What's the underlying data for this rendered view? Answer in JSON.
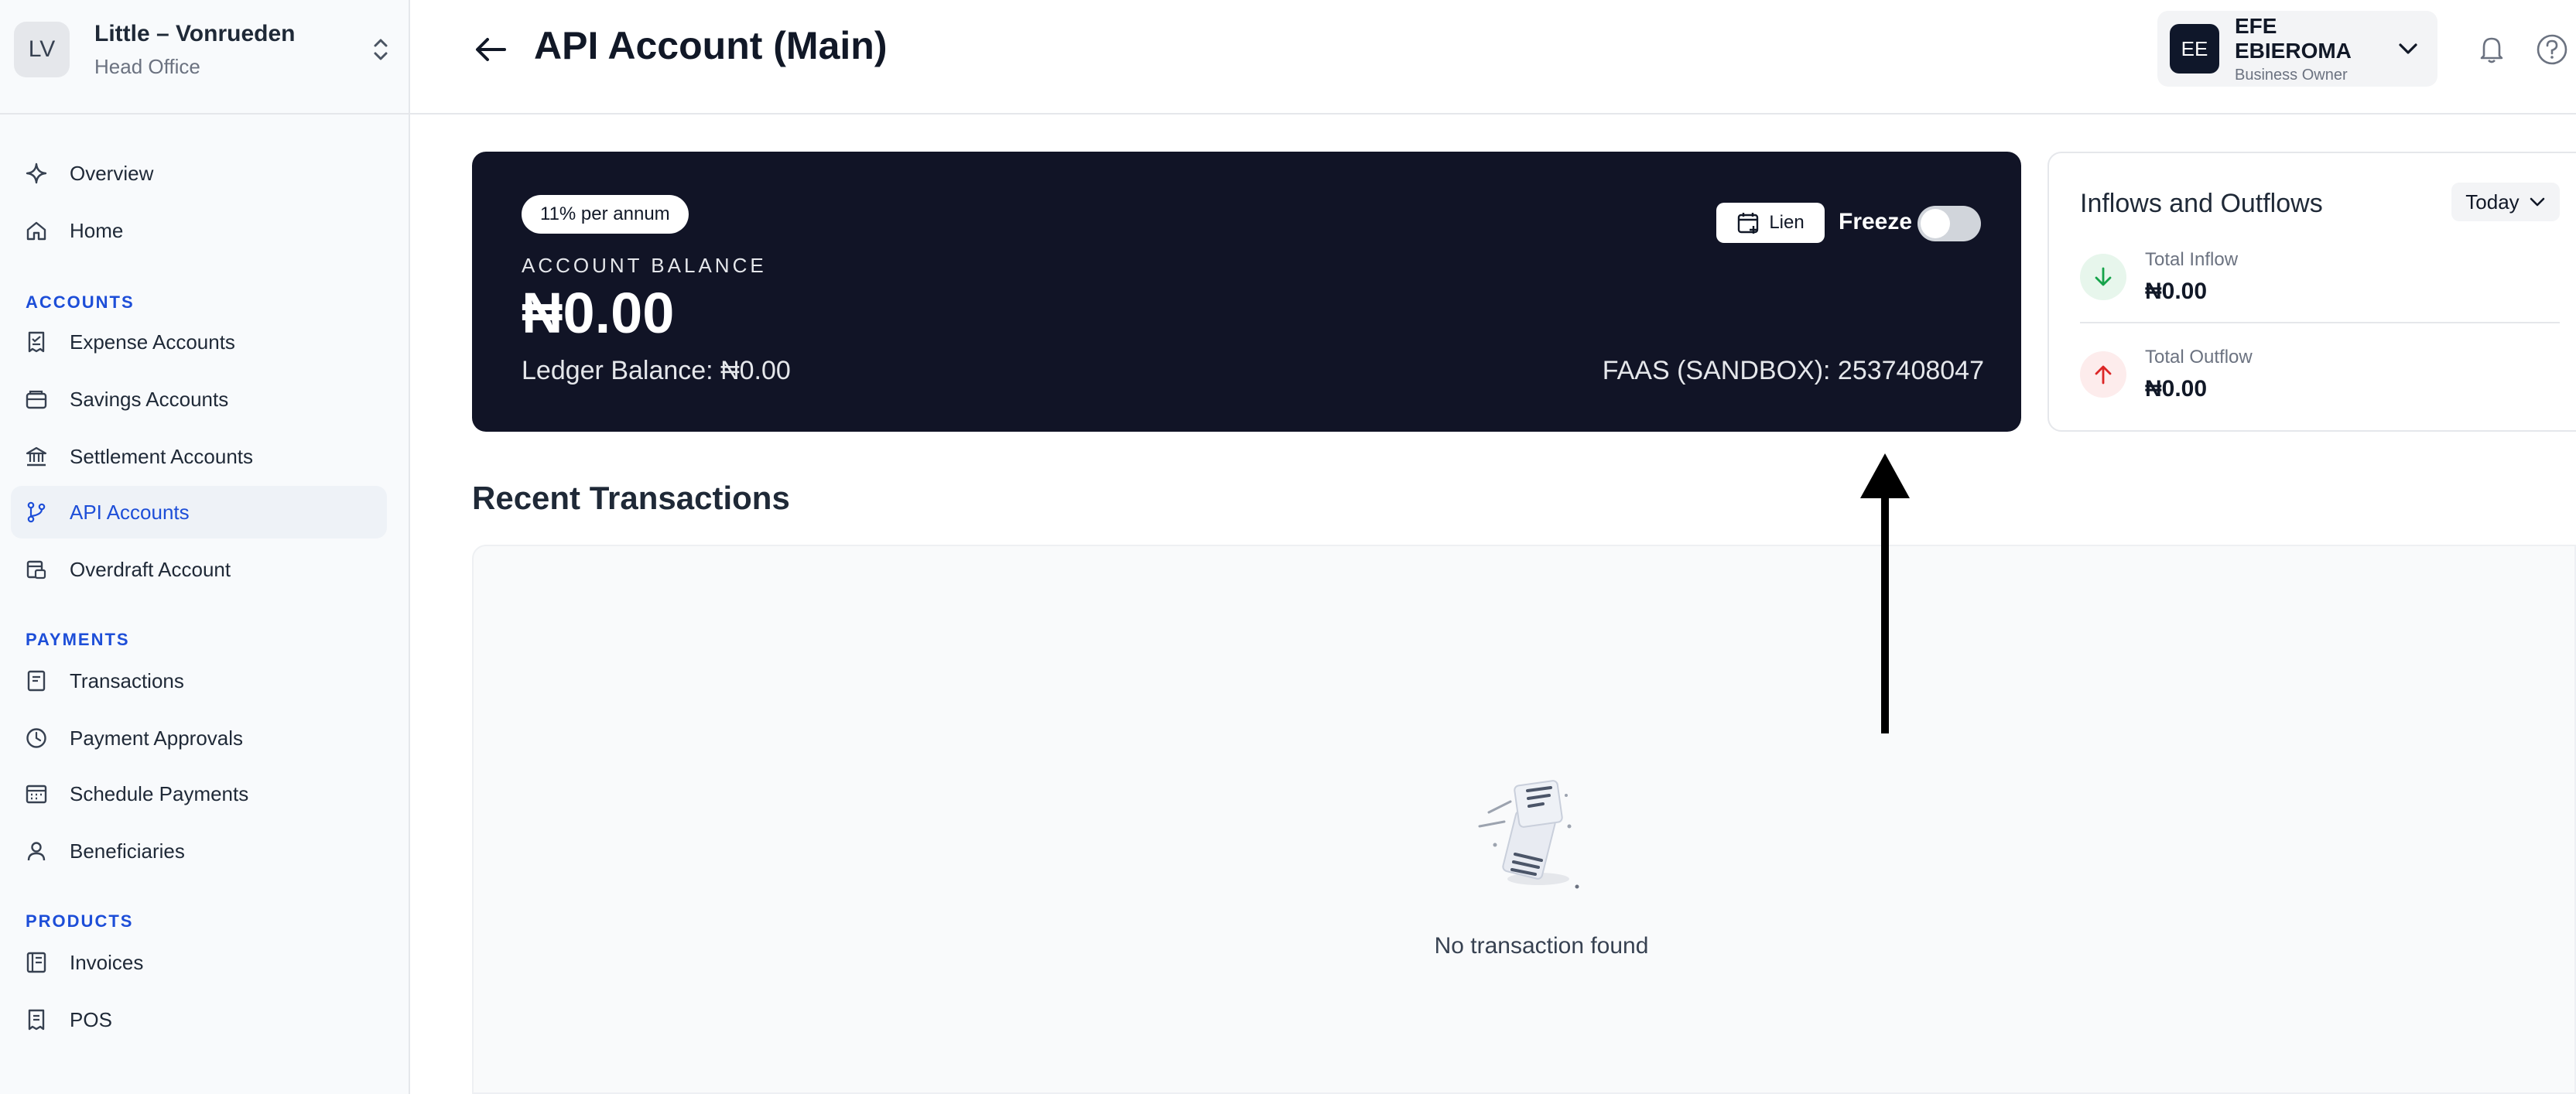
{
  "organization": {
    "initials": "LV",
    "name": "Little – Vonrueden",
    "branch": "Head Office"
  },
  "sidebar": {
    "top_items": [
      {
        "label": "Overview",
        "icon": "sparkle-icon"
      },
      {
        "label": "Home",
        "icon": "home-icon"
      }
    ],
    "sections": [
      {
        "title": "ACCOUNTS",
        "items": [
          {
            "label": "Expense Accounts",
            "icon": "receipt-icon"
          },
          {
            "label": "Savings Accounts",
            "icon": "wallet-icon"
          },
          {
            "label": "Settlement Accounts",
            "icon": "bank-icon"
          },
          {
            "label": "API Accounts",
            "icon": "git-branch-icon",
            "active": true
          },
          {
            "label": "Overdraft Account",
            "icon": "card-icon"
          }
        ]
      },
      {
        "title": "PAYMENTS",
        "items": [
          {
            "label": "Transactions",
            "icon": "document-icon"
          },
          {
            "label": "Payment Approvals",
            "icon": "clock-icon"
          },
          {
            "label": "Schedule Payments",
            "icon": "calendar-icon"
          },
          {
            "label": "Beneficiaries",
            "icon": "user-icon"
          }
        ]
      },
      {
        "title": "PRODUCTS",
        "items": [
          {
            "label": "Invoices",
            "icon": "invoice-icon"
          },
          {
            "label": "POS",
            "icon": "pos-icon"
          }
        ]
      }
    ]
  },
  "header": {
    "title": "API Account (Main)",
    "user": {
      "initials": "EE",
      "name": "EFE EBIEROMA",
      "role": "Business Owner"
    }
  },
  "account_card": {
    "rate": "11% per annum",
    "balance_label": "ACCOUNT BALANCE",
    "balance": "₦0.00",
    "ledger": "Ledger Balance: ₦0.00",
    "account_id": "FAAS (SANDBOX): 2537408047",
    "lien_label": "Lien",
    "freeze_label": "Freeze",
    "freeze_on": false
  },
  "flows": {
    "title": "Inflows and Outflows",
    "period": "Today",
    "inflow": {
      "label": "Total Inflow",
      "value": "₦0.00"
    },
    "outflow": {
      "label": "Total Outflow",
      "value": "₦0.00"
    }
  },
  "transactions": {
    "title": "Recent Transactions",
    "empty_message": "No transaction found"
  },
  "colors": {
    "accent": "#1d4ed8",
    "card_dark": "#111426",
    "inflow": "#16a34a",
    "outflow": "#dc2626"
  }
}
